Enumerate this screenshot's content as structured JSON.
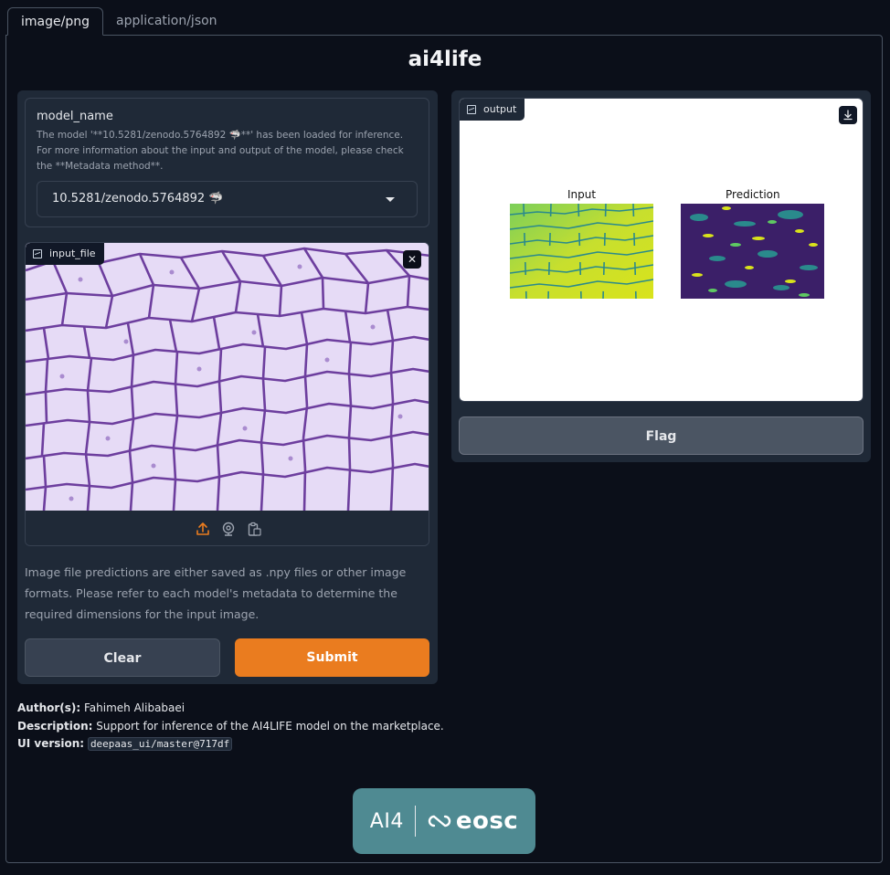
{
  "tabs": [
    {
      "label": "image/png",
      "active": true
    },
    {
      "label": "application/json",
      "active": false
    }
  ],
  "app": {
    "title": "ai4life"
  },
  "model": {
    "label": "model_name",
    "info": "The model '**10.5281/zenodo.5764892 🦈**' has been loaded for inference. For more information about the input and output of the model, please check the **Metadata method**.",
    "selected": "10.5281/zenodo.5764892 🦈"
  },
  "input": {
    "label": "input_file",
    "tools": [
      "upload-icon",
      "webcam-icon",
      "clipboard-icon"
    ]
  },
  "note": "Image file predictions are either saved as .npy files or other image formats. Please refer to each model's metadata to determine the required dimensions for the input image.",
  "buttons": {
    "clear": "Clear",
    "submit": "Submit",
    "flag": "Flag"
  },
  "output": {
    "label": "output",
    "panels": [
      {
        "title": "Input"
      },
      {
        "title": "Prediction"
      }
    ]
  },
  "meta": {
    "author_label": "Author(s):",
    "author_value": " Fahimeh Alibabaei",
    "description_label": "Description:",
    "description_value": " Support for inference of the AI4LIFE model on the marketplace.",
    "version_label": "UI version:",
    "version_value": "deepaas_ui/master@717df"
  },
  "logo": {
    "left": "AI4",
    "right": "eosc"
  },
  "colors": {
    "background": "#0b0f19",
    "panel": "#1f2937",
    "accent": "#ea7c1f",
    "logo": "#4f8a92"
  }
}
